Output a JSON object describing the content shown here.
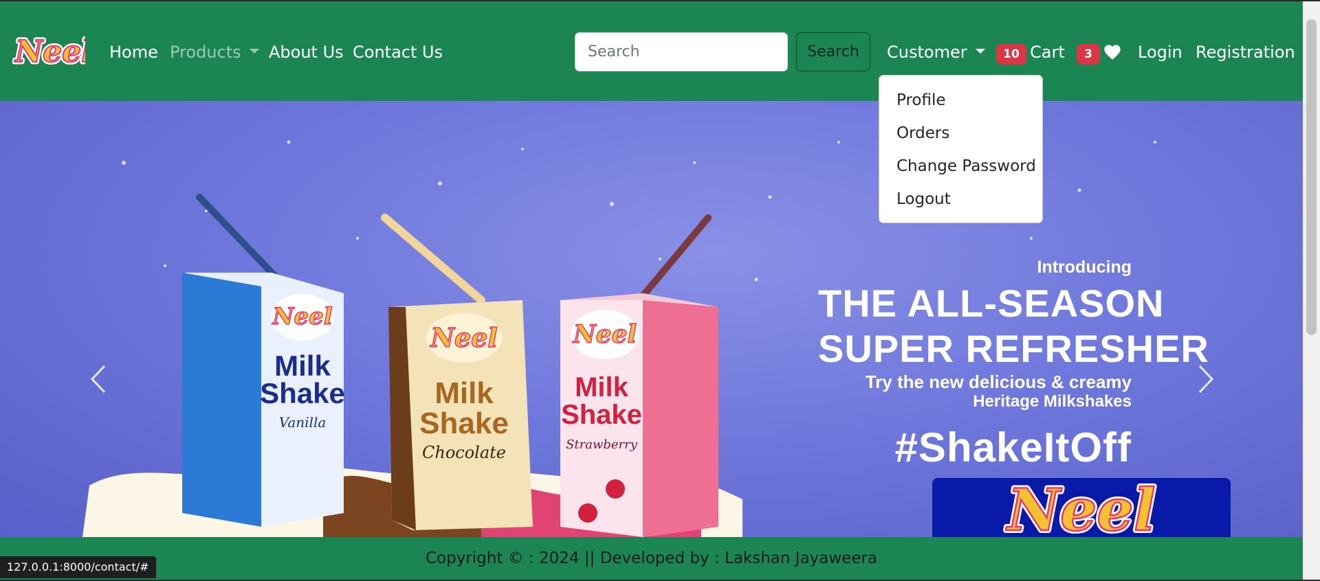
{
  "navbar": {
    "brand": "Neel",
    "links": {
      "home": "Home",
      "products": "Products",
      "about": "About Us",
      "contact": "Contact Us"
    },
    "search": {
      "placeholder": "Search",
      "button": "Search"
    },
    "customer_menu": "Customer",
    "cart": {
      "count": "10",
      "label": "Cart"
    },
    "wishlist": {
      "count": "3"
    },
    "login": "Login",
    "registration": "Registration"
  },
  "dropdown": {
    "items": [
      "Profile",
      "Orders",
      "Change Password",
      "Logout"
    ]
  },
  "hero": {
    "intro": "Introducing",
    "headline_line1": "THE ALL-SEASON",
    "headline_line2": "SUPER REFRESHER",
    "sub1": "Try the new delicious & creamy",
    "sub2": "Heritage Milkshakes",
    "tag": "#ShakeItOff",
    "brand": "Neel",
    "products": [
      {
        "brand": "Neel",
        "line1": "Milk",
        "line2": "Shake",
        "flavor": "Vanilla"
      },
      {
        "brand": "Neel",
        "line1": "Milk",
        "line2": "Shake",
        "flavor": "Chocolate"
      },
      {
        "brand": "Neel",
        "line1": "Milk",
        "line2": "Shake",
        "flavor": "Strawberry"
      }
    ]
  },
  "footer": {
    "text": "Copyright © : 2024 || Developed by : Lakshan Jayaweera"
  },
  "status_url": "127.0.0.1:8000/contact/#",
  "colors": {
    "navbar": "#1b8654",
    "badge": "#dc3545",
    "hero_bg": "#6f78dc",
    "logo_box": "#0a1aa8"
  },
  "icons": [
    "heart-icon",
    "chevron-left-icon",
    "chevron-right-icon",
    "caret-down-icon"
  ]
}
